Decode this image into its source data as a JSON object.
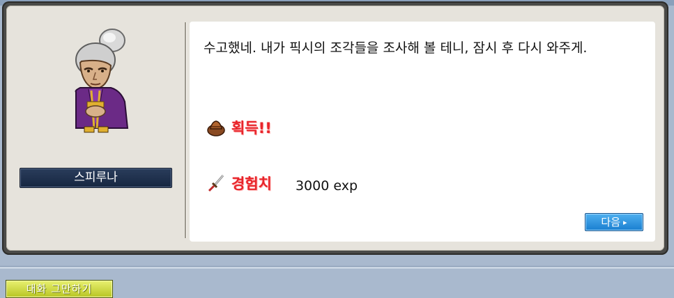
{
  "npc": {
    "name": "스피루나"
  },
  "dialog": {
    "message": "수고했네. 내가 픽시의 조각들을 조사해 볼 테니, 잠시 후 다시 와주게.",
    "rewards": {
      "acquire_label": "획득!!",
      "acquire_icon": "leather-bag-icon",
      "exp_label": "경험치",
      "exp_icon": "sword-icon",
      "exp_value": "3000 exp"
    },
    "next_button": {
      "label": "다음",
      "arrow": "▸"
    }
  },
  "bottom": {
    "end_chat_label": "대화 그만하기"
  },
  "colors": {
    "reward_label": "#e8242a",
    "next_button": "#1a7fd0",
    "end_chat_button": "#b8c524",
    "name_plate": "#1d2f4e"
  }
}
